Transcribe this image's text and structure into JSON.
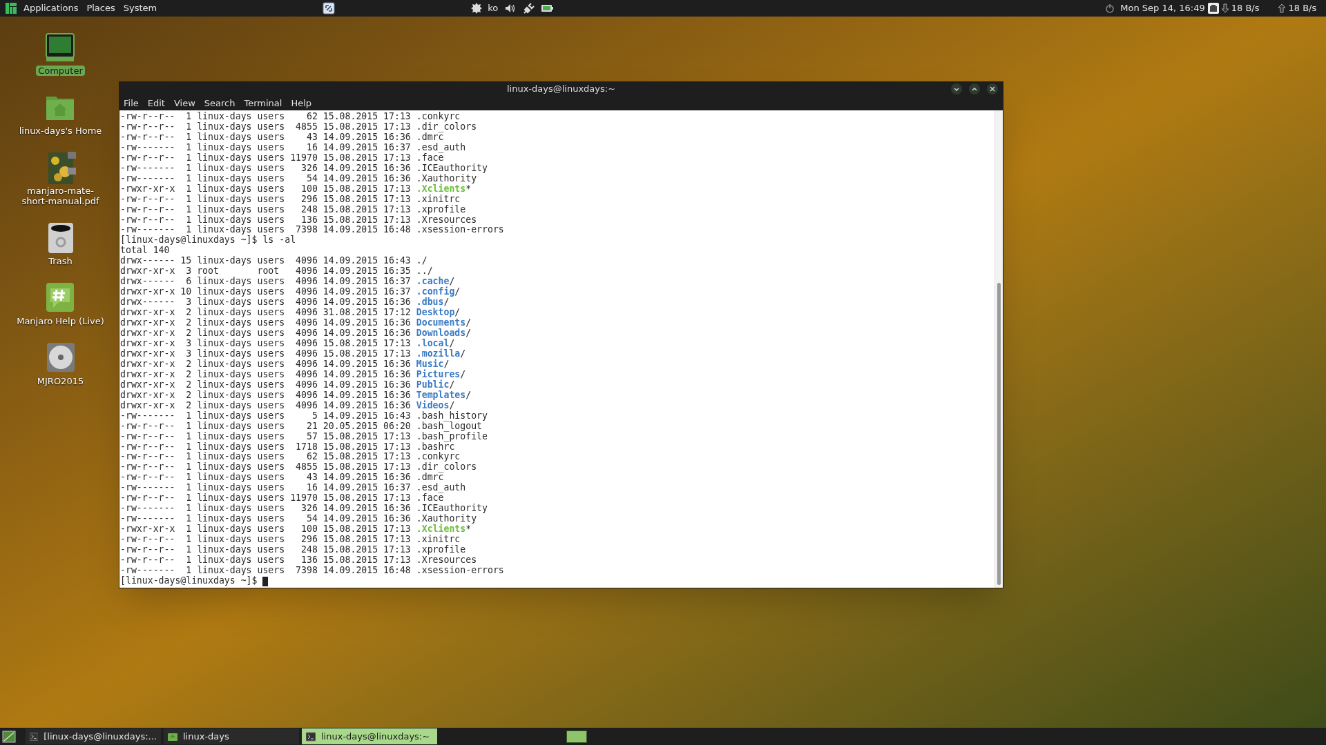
{
  "top_panel": {
    "menus": [
      "Applications",
      "Places",
      "System"
    ],
    "keyboard_layout": "ko",
    "clock": "Mon Sep 14, 16:49",
    "download_rate": "18 B/s",
    "upload_rate": "18 B/s"
  },
  "desktop_icons": [
    {
      "label": "Computer",
      "kind": "computer",
      "selected": true
    },
    {
      "label": "linux-days's Home",
      "kind": "home",
      "selected": false
    },
    {
      "label": "manjaro-mate-short-manual.pdf",
      "kind": "document",
      "selected": false
    },
    {
      "label": "Trash",
      "kind": "trash",
      "selected": false
    },
    {
      "label": "Manjaro Help (Live)",
      "kind": "help",
      "selected": false
    },
    {
      "label": "MJRO2015",
      "kind": "disc",
      "selected": false
    }
  ],
  "window": {
    "title": "linux-days@linuxdays:~",
    "menu": [
      "File",
      "Edit",
      "View",
      "Search",
      "Terminal",
      "Help"
    ],
    "lines": [
      {
        "kind": "file",
        "text": "-rw-r--r--  1 linux-days users    62 15.08.2015 17:13 ",
        "name": ".conkyrc"
      },
      {
        "kind": "file",
        "text": "-rw-r--r--  1 linux-days users  4855 15.08.2015 17:13 ",
        "name": ".dir_colors"
      },
      {
        "kind": "file",
        "text": "-rw-r--r--  1 linux-days users    43 14.09.2015 16:36 ",
        "name": ".dmrc"
      },
      {
        "kind": "file",
        "text": "-rw-------  1 linux-days users    16 14.09.2015 16:37 ",
        "name": ".esd_auth"
      },
      {
        "kind": "file",
        "text": "-rw-r--r--  1 linux-days users 11970 15.08.2015 17:13 ",
        "name": ".face"
      },
      {
        "kind": "file",
        "text": "-rw-------  1 linux-days users   326 14.09.2015 16:36 ",
        "name": ".ICEauthority"
      },
      {
        "kind": "file",
        "text": "-rw-------  1 linux-days users    54 14.09.2015 16:36 ",
        "name": ".Xauthority"
      },
      {
        "kind": "exec",
        "text": "-rwxr-xr-x  1 linux-days users   100 15.08.2015 17:13 ",
        "name": ".Xclients",
        "suffix": "*"
      },
      {
        "kind": "file",
        "text": "-rw-r--r--  1 linux-days users   296 15.08.2015 17:13 ",
        "name": ".xinitrc"
      },
      {
        "kind": "file",
        "text": "-rw-r--r--  1 linux-days users   248 15.08.2015 17:13 ",
        "name": ".xprofile"
      },
      {
        "kind": "file",
        "text": "-rw-r--r--  1 linux-days users   136 15.08.2015 17:13 ",
        "name": ".Xresources"
      },
      {
        "kind": "file",
        "text": "-rw-------  1 linux-days users  7398 14.09.2015 16:48 ",
        "name": ".xsession-errors"
      },
      {
        "kind": "prompt",
        "text": "[linux-days@linuxdays ~]$ ls -al",
        "cursor": false
      },
      {
        "kind": "output",
        "text": "total 140"
      },
      {
        "kind": "file",
        "text": "drwx------ 15 linux-days users  4096 14.09.2015 16:43 ",
        "name": "./"
      },
      {
        "kind": "file",
        "text": "drwxr-xr-x  3 root       root   4096 14.09.2015 16:35 ",
        "name": "../"
      },
      {
        "kind": "dir",
        "text": "drwx------  6 linux-days users  4096 14.09.2015 16:37 ",
        "name": ".cache",
        "suffix": "/"
      },
      {
        "kind": "dir",
        "text": "drwxr-xr-x 10 linux-days users  4096 14.09.2015 16:37 ",
        "name": ".config",
        "suffix": "/"
      },
      {
        "kind": "dir",
        "text": "drwx------  3 linux-days users  4096 14.09.2015 16:36 ",
        "name": ".dbus",
        "suffix": "/"
      },
      {
        "kind": "dir",
        "text": "drwxr-xr-x  2 linux-days users  4096 31.08.2015 17:12 ",
        "name": "Desktop",
        "suffix": "/"
      },
      {
        "kind": "dir",
        "text": "drwxr-xr-x  2 linux-days users  4096 14.09.2015 16:36 ",
        "name": "Documents",
        "suffix": "/"
      },
      {
        "kind": "dir",
        "text": "drwxr-xr-x  2 linux-days users  4096 14.09.2015 16:36 ",
        "name": "Downloads",
        "suffix": "/"
      },
      {
        "kind": "dir",
        "text": "drwxr-xr-x  3 linux-days users  4096 15.08.2015 17:13 ",
        "name": ".local",
        "suffix": "/"
      },
      {
        "kind": "dir",
        "text": "drwxr-xr-x  3 linux-days users  4096 15.08.2015 17:13 ",
        "name": ".mozilla",
        "suffix": "/"
      },
      {
        "kind": "dir",
        "text": "drwxr-xr-x  2 linux-days users  4096 14.09.2015 16:36 ",
        "name": "Music",
        "suffix": "/"
      },
      {
        "kind": "dir",
        "text": "drwxr-xr-x  2 linux-days users  4096 14.09.2015 16:36 ",
        "name": "Pictures",
        "suffix": "/"
      },
      {
        "kind": "dir",
        "text": "drwxr-xr-x  2 linux-days users  4096 14.09.2015 16:36 ",
        "name": "Public",
        "suffix": "/"
      },
      {
        "kind": "dir",
        "text": "drwxr-xr-x  2 linux-days users  4096 14.09.2015 16:36 ",
        "name": "Templates",
        "suffix": "/"
      },
      {
        "kind": "dir",
        "text": "drwxr-xr-x  2 linux-days users  4096 14.09.2015 16:36 ",
        "name": "Videos",
        "suffix": "/"
      },
      {
        "kind": "file",
        "text": "-rw-------  1 linux-days users     5 14.09.2015 16:43 ",
        "name": ".bash_history"
      },
      {
        "kind": "file",
        "text": "-rw-r--r--  1 linux-days users    21 20.05.2015 06:20 ",
        "name": ".bash_logout"
      },
      {
        "kind": "file",
        "text": "-rw-r--r--  1 linux-days users    57 15.08.2015 17:13 ",
        "name": ".bash_profile"
      },
      {
        "kind": "file",
        "text": "-rw-r--r--  1 linux-days users  1718 15.08.2015 17:13 ",
        "name": ".bashrc"
      },
      {
        "kind": "file",
        "text": "-rw-r--r--  1 linux-days users    62 15.08.2015 17:13 ",
        "name": ".conkyrc"
      },
      {
        "kind": "file",
        "text": "-rw-r--r--  1 linux-days users  4855 15.08.2015 17:13 ",
        "name": ".dir_colors"
      },
      {
        "kind": "file",
        "text": "-rw-r--r--  1 linux-days users    43 14.09.2015 16:36 ",
        "name": ".dmrc"
      },
      {
        "kind": "file",
        "text": "-rw-------  1 linux-days users    16 14.09.2015 16:37 ",
        "name": ".esd_auth"
      },
      {
        "kind": "file",
        "text": "-rw-r--r--  1 linux-days users 11970 15.08.2015 17:13 ",
        "name": ".face"
      },
      {
        "kind": "file",
        "text": "-rw-------  1 linux-days users   326 14.09.2015 16:36 ",
        "name": ".ICEauthority"
      },
      {
        "kind": "file",
        "text": "-rw-------  1 linux-days users    54 14.09.2015 16:36 ",
        "name": ".Xauthority"
      },
      {
        "kind": "exec",
        "text": "-rwxr-xr-x  1 linux-days users   100 15.08.2015 17:13 ",
        "name": ".Xclients",
        "suffix": "*"
      },
      {
        "kind": "file",
        "text": "-rw-r--r--  1 linux-days users   296 15.08.2015 17:13 ",
        "name": ".xinitrc"
      },
      {
        "kind": "file",
        "text": "-rw-r--r--  1 linux-days users   248 15.08.2015 17:13 ",
        "name": ".xprofile"
      },
      {
        "kind": "file",
        "text": "-rw-r--r--  1 linux-days users   136 15.08.2015 17:13 ",
        "name": ".Xresources"
      },
      {
        "kind": "file",
        "text": "-rw-------  1 linux-days users  7398 14.09.2015 16:48 ",
        "name": ".xsession-errors"
      },
      {
        "kind": "prompt",
        "text": "[linux-days@linuxdays ~]$ ",
        "cursor": true
      }
    ]
  },
  "taskbar": {
    "tasks": [
      {
        "label": "[linux-days@linuxdays:...",
        "kind": "terminal",
        "selected": false
      },
      {
        "label": "linux-days",
        "kind": "folder",
        "selected": false
      },
      {
        "label": "linux-days@linuxdays:~",
        "kind": "terminal",
        "selected": true
      }
    ],
    "workspaces": [
      {
        "selected": true
      }
    ]
  }
}
